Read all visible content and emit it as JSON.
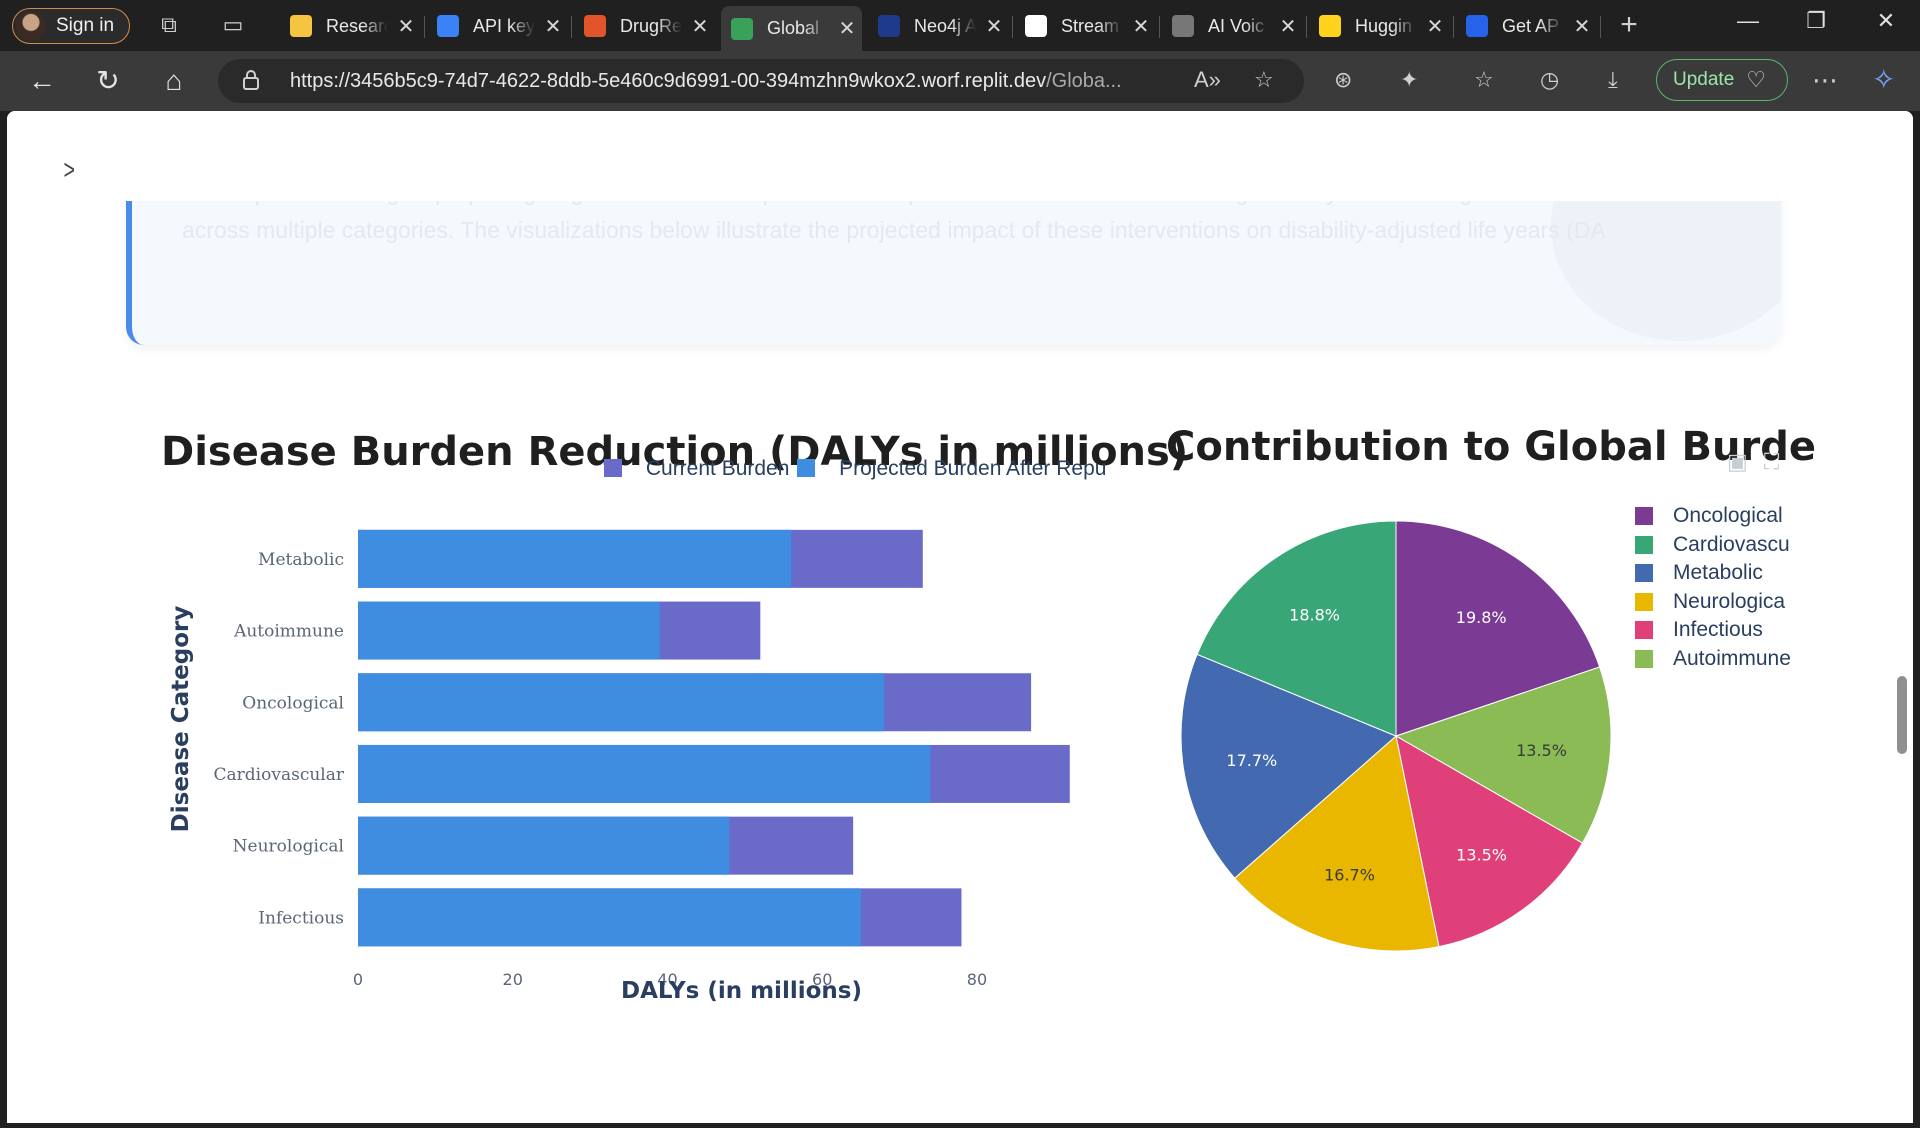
{
  "browser": {
    "signin_label": "Sign in",
    "tabs": [
      {
        "title": "Research",
        "favicon_color": "#f5c542"
      },
      {
        "title": "API keys",
        "favicon_color": "#3b82f6"
      },
      {
        "title": "DrugRe",
        "favicon_color": "#e2552b"
      },
      {
        "title": "Global",
        "favicon_color": "#3aa15a",
        "active": true
      },
      {
        "title": "Neo4j A",
        "favicon_color": "#1e3a8a"
      },
      {
        "title": "Stream",
        "favicon_color": "#ffffff"
      },
      {
        "title": "AI Voic",
        "favicon_color": "#777777"
      },
      {
        "title": "Huggin",
        "favicon_color": "#ffd21e"
      },
      {
        "title": "Get AP",
        "favicon_color": "#2563eb"
      }
    ],
    "url_host": "https://3456b5c9-74d7-4622-8ddb-5e460c9d6991-00-394mzhn9wkox2.worf.replit.dev",
    "url_path": "/Globa...",
    "update_label": "Update"
  },
  "page": {
    "intro_text": "Our AI-powered Drug Repurposing Engine has identified potential therapeutic interventions that could significantly reduce the global disease burden across multiple categories. The visualizations below illustrate the projected impact of these interventions on disability-adjusted life years (DA"
  },
  "colors": {
    "current": "#6a6ac8",
    "projected": "#3f8de0",
    "accent": "#4a8bea"
  },
  "chart_data": [
    {
      "type": "bar",
      "orientation": "horizontal",
      "barmode": "overlay",
      "title": "Disease Burden Reduction (DALYs in millions)",
      "xlabel": "DALYs (in millions)",
      "ylabel": "Disease Category",
      "categories": [
        "Metabolic",
        "Autoimmune",
        "Oncological",
        "Cardiovascular",
        "Neurological",
        "Infectious"
      ],
      "series": [
        {
          "name": "Current Burden",
          "color": "#6a6ac8",
          "values": [
            73,
            52,
            87,
            92,
            64,
            78
          ]
        },
        {
          "name": "Projected Burden After Repu",
          "color": "#3f8de0",
          "values": [
            56,
            39,
            68,
            74,
            48,
            65
          ]
        }
      ],
      "xticks": [
        0,
        20,
        40,
        60,
        80
      ],
      "xlim": [
        0,
        95
      ],
      "legend_position": "top"
    },
    {
      "type": "pie",
      "title": "Contribution to Global Burden R",
      "slices": [
        {
          "label": "Oncological",
          "value": 19.8,
          "color": "#7b3a93"
        },
        {
          "label": "Autoimmune",
          "value": 13.5,
          "color": "#8bbb54"
        },
        {
          "label": "Infectious",
          "value": 13.5,
          "color": "#e0407a"
        },
        {
          "label": "Neurological",
          "value": 16.7,
          "color": "#e9b600"
        },
        {
          "label": "Metabolic",
          "value": 17.7,
          "color": "#4369b0"
        },
        {
          "label": "Cardiovascu",
          "value": 18.8,
          "color": "#39a677"
        }
      ],
      "legend": [
        "Oncological",
        "Cardiovascu",
        "Metabolic",
        "Neurologica",
        "Infectious",
        "Autoimmune"
      ],
      "legend_position": "right"
    }
  ]
}
